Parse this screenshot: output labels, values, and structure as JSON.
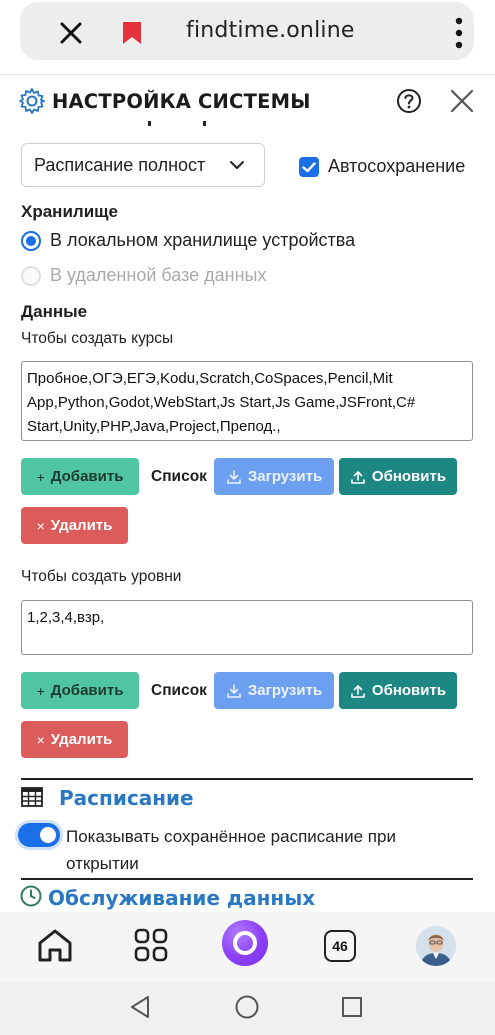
{
  "browser": {
    "url": "findtime.online",
    "tab_count": "46"
  },
  "panel": {
    "title": "НАСТРОЙКА СИСТЕМЫ",
    "mode_select_value": "Расписание полност",
    "autosave_label": "Автосохранение",
    "autosave_checked": true
  },
  "storage": {
    "heading": "Хранилище",
    "options": [
      {
        "label": "В локальном хранилище устройства",
        "selected": true
      },
      {
        "label": "В удаленной базе данных",
        "selected": false
      }
    ]
  },
  "data_section": {
    "heading": "Данные",
    "courses": {
      "label": "Чтобы создать курсы",
      "value": "Пробное,ОГЭ,ЕГЭ,Kodu,Scratch,CoSpaces,Pencil,Mit App,Python,Godot,WebStart,Js Start,Js Game,JSFront,C# Start,Unity,PHP,Java,Project,Препод.,"
    },
    "levels": {
      "label": "Чтобы создать уровни",
      "value": "1,2,3,4,взр,"
    },
    "buttons": {
      "add": "Добавить",
      "list": "Список",
      "load": "Загрузить",
      "update": "Обновить",
      "delete": "Удалить"
    }
  },
  "schedule": {
    "heading": "Расписание",
    "show_saved_label": "Показывать сохранённое расписание при открытии",
    "show_saved_on": true
  },
  "maintenance": {
    "heading": "Обслуживание данных"
  },
  "colors": {
    "accent_blue": "#1a6fe8",
    "add_green": "#4fc5a1",
    "load_blue": "#6d9ff0",
    "update_teal": "#1c8783",
    "delete_red": "#dc5c5c",
    "section_blue": "#2a78c2"
  }
}
